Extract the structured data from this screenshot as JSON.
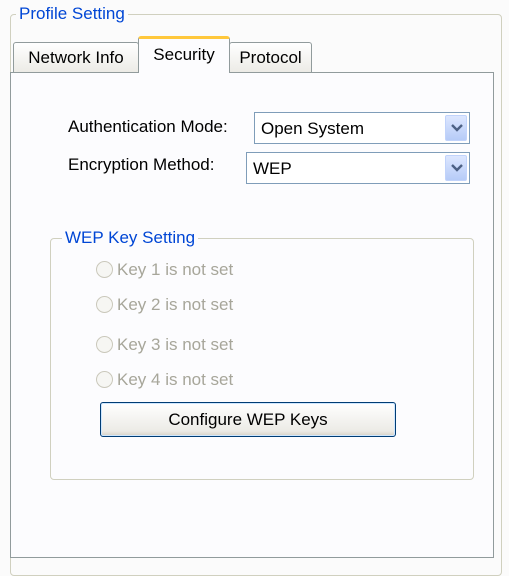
{
  "profile_group": {
    "title": "Profile Setting"
  },
  "tabs": [
    {
      "label": "Network Info",
      "active": false
    },
    {
      "label": "Security",
      "active": true
    },
    {
      "label": "Protocol",
      "active": false
    }
  ],
  "security": {
    "auth_mode": {
      "label": "Authentication Mode:",
      "value": "Open System"
    },
    "encryption": {
      "label": "Encryption Method:",
      "value": "WEP"
    }
  },
  "wep_group": {
    "title": "WEP Key Setting",
    "keys": [
      {
        "label": "Key 1 is not set"
      },
      {
        "label": "Key 2 is not set"
      },
      {
        "label": "Key 3 is not set"
      },
      {
        "label": "Key 4 is not set"
      }
    ],
    "configure_button": "Configure WEP Keys"
  },
  "colors": {
    "accent": "#0046d5",
    "disabled_text": "#a7a69a",
    "active_tab_highlight": "#ffc83c"
  },
  "icons": {
    "dropdown": "chevron-down-icon",
    "radio": "radio-icon"
  }
}
